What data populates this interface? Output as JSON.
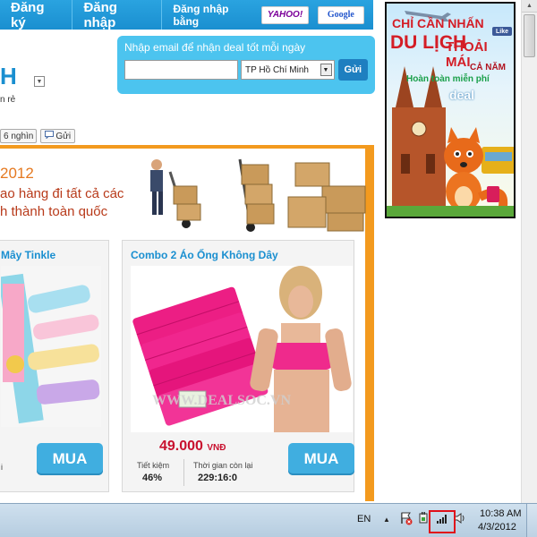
{
  "nav": {
    "register": "Đăng ký",
    "login": "Đăng nhập",
    "login_with": "Đăng nhập bằng",
    "yahoo": "YAHOO!",
    "google": "Google"
  },
  "subscribe": {
    "title": "Nhập email để nhận deal tốt mỗi ngày",
    "email_value": "",
    "email_placeholder": "",
    "city": "TP Hồ Chí Minh",
    "send": "Gửi"
  },
  "site": {
    "logo_fragment": "H",
    "tagline_fragment": "n rẻ"
  },
  "share": {
    "count": "6 nghìn",
    "send_label": "Gửi"
  },
  "banner": {
    "year": "2012",
    "line1": "ao hàng đi tất cả các",
    "line2": "h thành toàn quốc"
  },
  "products": [
    {
      "title": "Mây Tinkle",
      "buy": "MUA",
      "savings_label": "i"
    },
    {
      "title": "Combo 2 Áo Ống Không Dây",
      "price": "49.000",
      "currency": "VNĐ",
      "savings_label": "Tiết kiệm",
      "savings_value": "46%",
      "time_label": "Thời gian còn lại",
      "time_value": "229:16:0",
      "buy": "MUA",
      "watermark": "WWW.DEALSOC.VN"
    }
  ],
  "ad": {
    "line1": "CHỈ CẦN NHẤN",
    "line2": "THOẢI MÁI",
    "line3": "DU LỊCH",
    "line4": "CẢ NĂM",
    "line5": "Hoàn toàn miễn phí",
    "brand": "deal",
    "like": "Like"
  },
  "taskbar": {
    "language": "EN",
    "time": "10:38 AM",
    "date": "4/3/2012"
  },
  "colors": {
    "nav_blue": "#1a8fd0",
    "orange_frame": "#f39a1e",
    "buy_button": "#40aee0",
    "price_red": "#c8102e",
    "highlight_red": "#e0101a"
  }
}
